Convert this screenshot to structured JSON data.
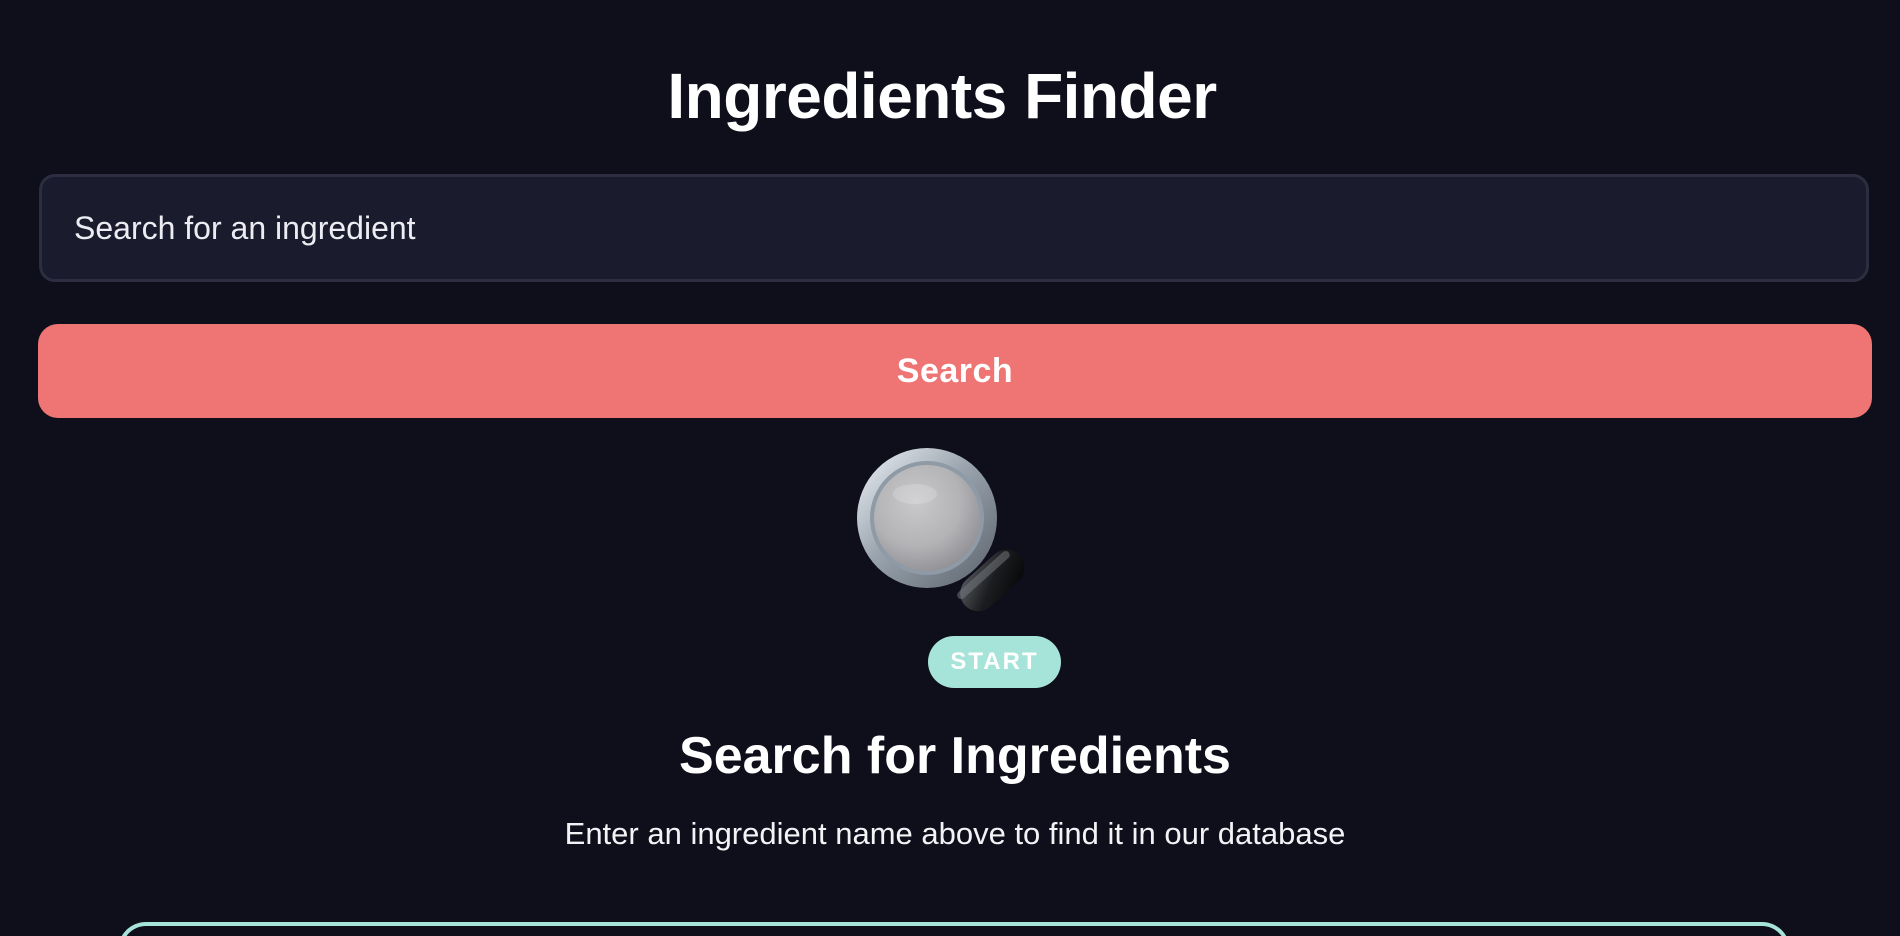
{
  "header": {
    "title": "Ingredients Finder"
  },
  "search": {
    "placeholder": "Search for an ingredient",
    "value": "",
    "button_label": "Search"
  },
  "empty_state": {
    "icon": "magnifying-glass-icon",
    "badge": "START",
    "title": "Search for Ingredients",
    "subtitle": "Enter an ingredient name above to find it in our database"
  },
  "colors": {
    "background": "#0e0f1b",
    "input_background": "#1a1b2d",
    "button": "#ee7573",
    "badge": "#a6e3d8"
  }
}
